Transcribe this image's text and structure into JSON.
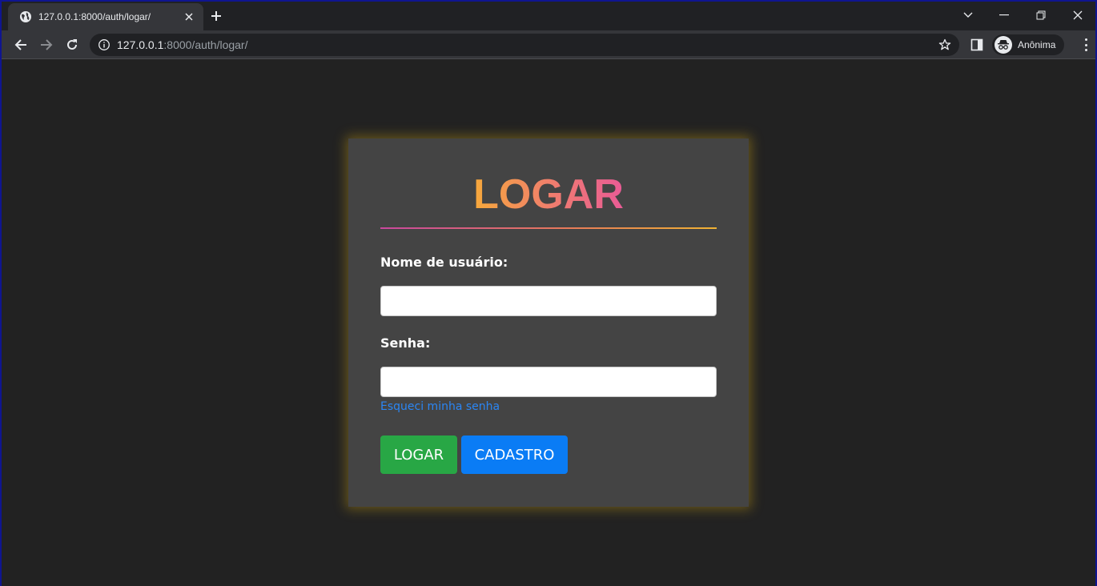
{
  "browser": {
    "tab": {
      "title": "127.0.0.1:8000/auth/logar/",
      "favicon": "globe-icon"
    },
    "address": {
      "host": "127.0.0.1",
      "path": ":8000/auth/logar/"
    },
    "profile_label": "Anônima",
    "icons": [
      "back-arrow-icon",
      "forward-arrow-icon",
      "reload-icon",
      "info-icon",
      "star-icon",
      "side-panel-icon",
      "incognito-icon",
      "kebab-menu-icon"
    ]
  },
  "login": {
    "title": "LOGAR",
    "username_label": "Nome de usuário:",
    "username_value": "",
    "password_label": "Senha:",
    "password_value": "",
    "forgot_password": "Esqueci minha senha",
    "login_button": "LOGAR",
    "register_button": "CADASTRO"
  },
  "colors": {
    "page_bg": "#222222",
    "card_bg": "#444444",
    "title_gradient": [
      "#f7a93b",
      "#e95b96"
    ],
    "login_button": "#28a745",
    "register_button": "#0a7cf5",
    "link": "#2b86f4"
  }
}
